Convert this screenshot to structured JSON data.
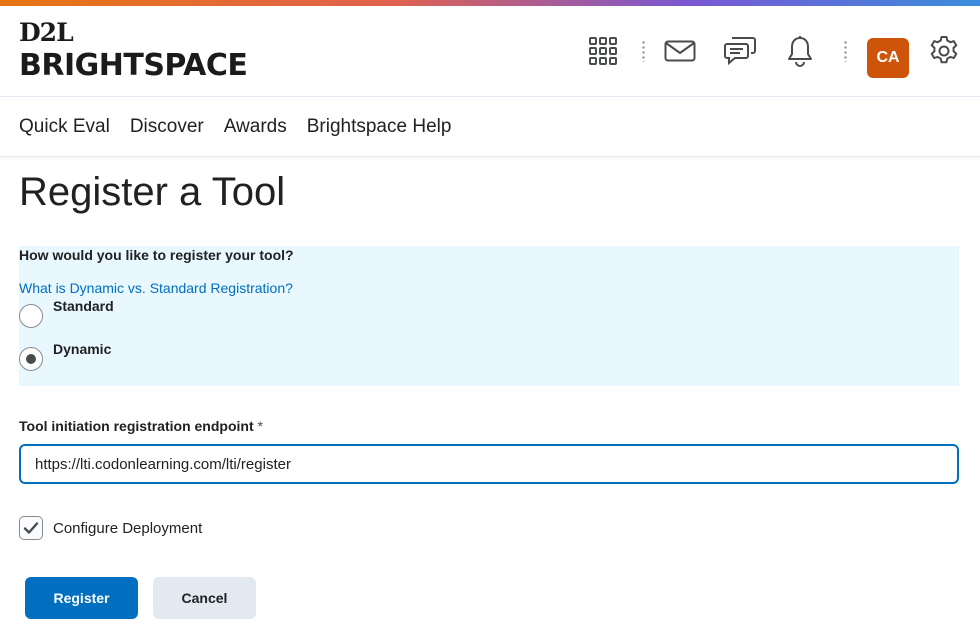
{
  "brand": {
    "top": "D2L",
    "bottom": "BRIGHTSPACE"
  },
  "header": {
    "icons": [
      "waffle-icon",
      "mail-icon",
      "chat-icon",
      "bell-icon",
      "gear-icon"
    ],
    "avatar_initials": "CA",
    "avatar_color": "#cd5408"
  },
  "nav": {
    "items": [
      "Quick Eval",
      "Discover",
      "Awards",
      "Brightspace Help"
    ]
  },
  "page": {
    "title": "Register a Tool"
  },
  "registration": {
    "question": "How would you like to register your tool?",
    "help_link": "What is Dynamic vs. Standard Registration?",
    "options": [
      "Standard",
      "Dynamic"
    ],
    "selected": "Dynamic"
  },
  "endpoint": {
    "label": "Tool initiation registration endpoint",
    "required_marker": "*",
    "value": "https://lti.codonlearning.com/lti/register"
  },
  "deployment": {
    "label": "Configure Deployment",
    "checked": true
  },
  "actions": {
    "register": "Register",
    "cancel": "Cancel"
  },
  "colors": {
    "primary": "#006fbf",
    "panel": "#e8f8fe",
    "link": "#006fbf"
  }
}
